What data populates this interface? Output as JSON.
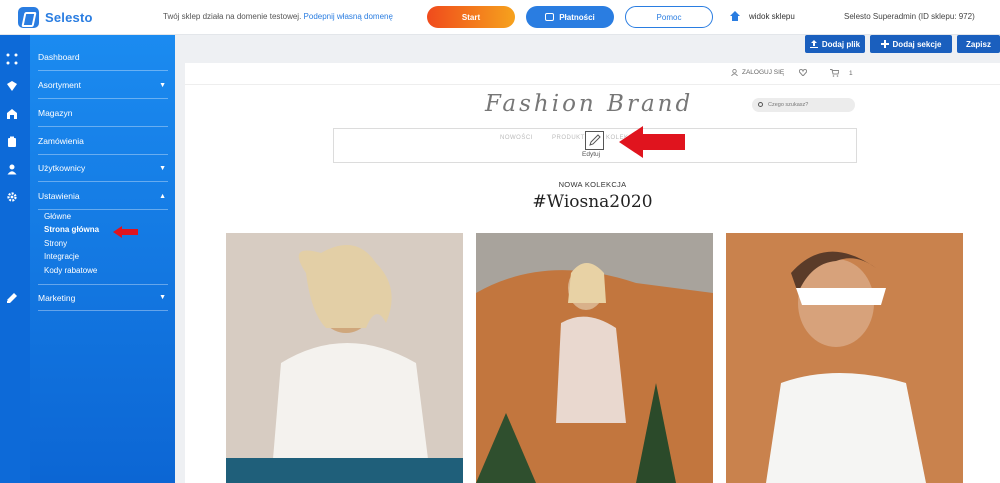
{
  "topbar": {
    "logo_text": "Selesto",
    "notice_text": "Twój sklep działa na domenie testowej.",
    "notice_link": "Podepnij własną domenę",
    "start_label": "Start",
    "payments_label": "Płatności",
    "help_label": "Pomoc",
    "shop_view_label": "widok sklepu",
    "admin_label": "Selesto Superadmin (ID sklepu: 972)"
  },
  "sidebar": {
    "items": [
      {
        "label": "Dashboard"
      },
      {
        "label": "Asortyment",
        "caret": "▼"
      },
      {
        "label": "Magazyn"
      },
      {
        "label": "Zamówienia"
      },
      {
        "label": "Użytkownicy",
        "caret": "▼"
      },
      {
        "label": "Ustawienia",
        "caret": "▲"
      },
      {
        "label": "Marketing",
        "caret": "▼"
      }
    ],
    "subitems": [
      "Główne",
      "Strona główna",
      "Strony",
      "Integracje",
      "Kody rabatowe"
    ]
  },
  "toolbar": {
    "add_file": "Dodaj plik",
    "add_section": "Dodaj sekcje",
    "save": "Zapisz"
  },
  "preview": {
    "login": "ZALOGUJ SIĘ",
    "cart_count": "1",
    "brand": "Fashion Brand",
    "search_placeholder": "Czego szukasz?",
    "menu": [
      "NOWOŚCI",
      "PRODUKTY",
      "KOLEKCJE"
    ],
    "edit_label": "Edytuj",
    "collection_label": "NOWA KOLEKCJA",
    "hashtag": "#Wiosna2020"
  },
  "colors": {
    "accent": "#2a7de1",
    "sidebar_top": "#1b8bf0",
    "sidebar_bottom": "#0c66d4",
    "start_from": "#f04b1c",
    "start_to": "#f6a21d",
    "annotation_arrow": "#e0141e"
  }
}
